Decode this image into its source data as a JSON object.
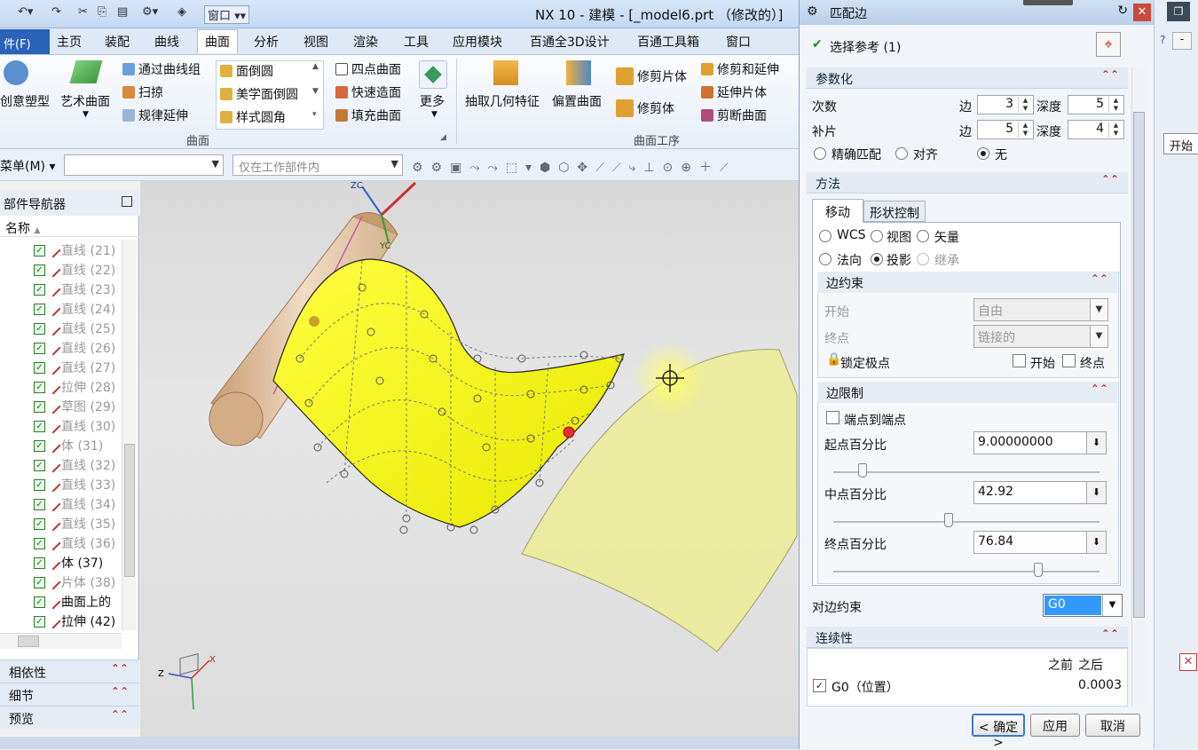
{
  "app": {
    "title": "NX 10 - 建模 - [_model6.prt （修改的）]",
    "window_menu": "窗口"
  },
  "menubar": {
    "file": "件(F)",
    "tabs": [
      "主页",
      "装配",
      "曲线",
      "曲面",
      "分析",
      "视图",
      "渲染",
      "工具",
      "应用模块",
      "百通全3D设计",
      "百通工具箱",
      "窗口"
    ],
    "active": "曲面"
  },
  "ribbon": {
    "big": [
      "创意塑型",
      "艺术曲面"
    ],
    "col1": [
      "通过曲线组",
      "扫掠",
      "规律延伸"
    ],
    "col2": [
      "面倒圆",
      "美学面倒圆",
      "样式圆角"
    ],
    "col3": [
      "四点曲面",
      "快速造面",
      "填充曲面"
    ],
    "more": "更多",
    "ops": [
      "抽取几何特征",
      "偏置曲面"
    ],
    "col4": [
      "修剪片体",
      "修剪体"
    ],
    "col5": [
      "修剪和延伸",
      "延伸片体",
      "剪断曲面"
    ],
    "group_surface": "曲面",
    "group_ops": "曲面工序"
  },
  "toolbar2": {
    "menu": "菜单(M)",
    "filter": "仅在工作部件内"
  },
  "navigator": {
    "title": "部件导航器",
    "name_header": "名称",
    "items": [
      {
        "label": "直线 (21)",
        "grey": true
      },
      {
        "label": "直线 (22)",
        "grey": true
      },
      {
        "label": "直线 (23)",
        "grey": true
      },
      {
        "label": "直线 (24)",
        "grey": true
      },
      {
        "label": "直线 (25)",
        "grey": true
      },
      {
        "label": "直线 (26)",
        "grey": true
      },
      {
        "label": "直线 (27)",
        "grey": true
      },
      {
        "label": "拉伸 (28)",
        "grey": true
      },
      {
        "label": "草图 (29)",
        "grey": true
      },
      {
        "label": "直线 (30)",
        "grey": true
      },
      {
        "label": "体 (31)",
        "grey": true
      },
      {
        "label": "直线 (32)",
        "grey": true
      },
      {
        "label": "直线 (33)",
        "grey": true
      },
      {
        "label": "直线 (34)",
        "grey": true
      },
      {
        "label": "直线 (35)",
        "grey": true
      },
      {
        "label": "直线 (36)",
        "grey": true
      },
      {
        "label": "体 (37)",
        "grey": false
      },
      {
        "label": "片体 (38)",
        "grey": true
      },
      {
        "label": "曲面上的",
        "grey": false
      },
      {
        "label": "拉伸 (42)",
        "grey": false
      }
    ],
    "sections": [
      "相依性",
      "细节",
      "预览"
    ]
  },
  "viewport": {
    "axes": {
      "zc": "ZC",
      "yc": "YC",
      "z": "Z",
      "x": "X"
    }
  },
  "dialog": {
    "title": "匹配边",
    "select_ref": "选择参考 (1)",
    "param": {
      "title": "参数化",
      "degree": "次数",
      "patch": "补片",
      "edge": "边",
      "depth": "深度",
      "deg_edge": "3",
      "deg_depth": "5",
      "patch_edge": "5",
      "patch_depth": "4",
      "opt_exact": "精确匹配",
      "opt_align": "对齐",
      "opt_none": "无"
    },
    "method": {
      "title": "方法",
      "tab_move": "移动",
      "tab_shape": "形状控制",
      "r_wcs": "WCS",
      "r_view": "视图",
      "r_vector": "矢量",
      "r_normal": "法向",
      "r_project": "投影",
      "r_inherit": "继承"
    },
    "edge_constraint": {
      "title": "边约束",
      "start": "开始",
      "end": "终点",
      "start_val": "自由",
      "end_val": "链接的",
      "lock": "锁定极点",
      "chk_start": "开始",
      "chk_end": "终点"
    },
    "edge_limit": {
      "title": "边限制",
      "endpoint": "端点到端点",
      "start_pct_label": "起点百分比",
      "start_pct": "9.00000000",
      "mid_pct_label": "中点百分比",
      "mid_pct": "42.92",
      "end_pct_label": "终点百分比",
      "end_pct": "76.84"
    },
    "opp_constraint": {
      "label": "对边约束",
      "value": "G0"
    },
    "continuity": {
      "title": "连续性",
      "before": "之前",
      "after": "之后",
      "row_label": "G0（位置）",
      "row_value": "0.0003"
    },
    "buttons": {
      "ok": "< 确定 >",
      "apply": "应用",
      "cancel": "取消"
    }
  },
  "right_panel": {
    "start_btn": "开始"
  }
}
